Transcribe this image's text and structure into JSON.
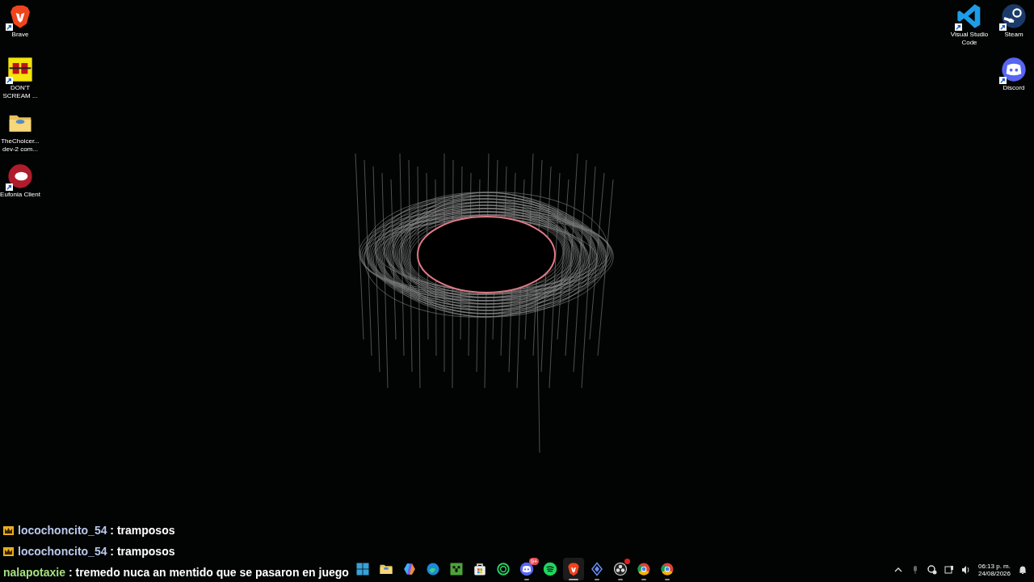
{
  "desktop": {
    "left_icons": [
      {
        "kind": "brave",
        "label": "Brave",
        "shortcut": true
      },
      {
        "kind": "ds",
        "label": "DON'T SCREAM ...",
        "shortcut": true
      },
      {
        "kind": "folder",
        "label": "TheChoicer... dev-2 com...",
        "shortcut": false
      },
      {
        "kind": "eufonia",
        "label": "Eufonia Client",
        "shortcut": true
      }
    ],
    "right_columns": [
      {
        "icons": [
          {
            "kind": "vscode",
            "label": "Visual Studio Code",
            "shortcut": true
          }
        ]
      },
      {
        "icons": [
          {
            "kind": "steam",
            "label": "Steam",
            "shortcut": true
          },
          {
            "kind": "discord",
            "label": "Discord",
            "shortcut": true
          }
        ]
      }
    ]
  },
  "chat": [
    {
      "user": "locochoncito_54",
      "separator": ":",
      "text": "tramposos",
      "crown": true,
      "color": "#b9c8ea"
    },
    {
      "user": "locochoncito_54",
      "separator": ":",
      "text": "tramposos",
      "crown": true,
      "color": "#b9c8ea"
    },
    {
      "user": "nalapotaxie",
      "separator": ":",
      "text": "tremedo nuca an mentido que se pasaron en juego",
      "crown": false,
      "color": "#a6e07e"
    }
  ],
  "taskbar": {
    "apps": [
      {
        "kind": "start",
        "running": false,
        "active": false
      },
      {
        "kind": "folder",
        "running": false,
        "active": false
      },
      {
        "kind": "copilot",
        "running": false,
        "active": false
      },
      {
        "kind": "edge",
        "running": false,
        "active": false
      },
      {
        "kind": "minecraft",
        "running": false,
        "active": false
      },
      {
        "kind": "store",
        "running": false,
        "active": false
      },
      {
        "kind": "ring",
        "running": false,
        "active": false
      },
      {
        "kind": "discord",
        "running": true,
        "active": false,
        "badge": "9+"
      },
      {
        "kind": "spotify",
        "running": false,
        "active": false
      },
      {
        "kind": "brave",
        "running": true,
        "active": true
      },
      {
        "kind": "diamond",
        "running": true,
        "active": false
      },
      {
        "kind": "obs",
        "running": true,
        "active": false,
        "dot": true
      },
      {
        "kind": "chrome",
        "running": true,
        "active": false
      },
      {
        "kind": "chrome",
        "running": true,
        "active": false
      }
    ],
    "time": "06:13 p. m.",
    "date": "24/08/2026"
  }
}
